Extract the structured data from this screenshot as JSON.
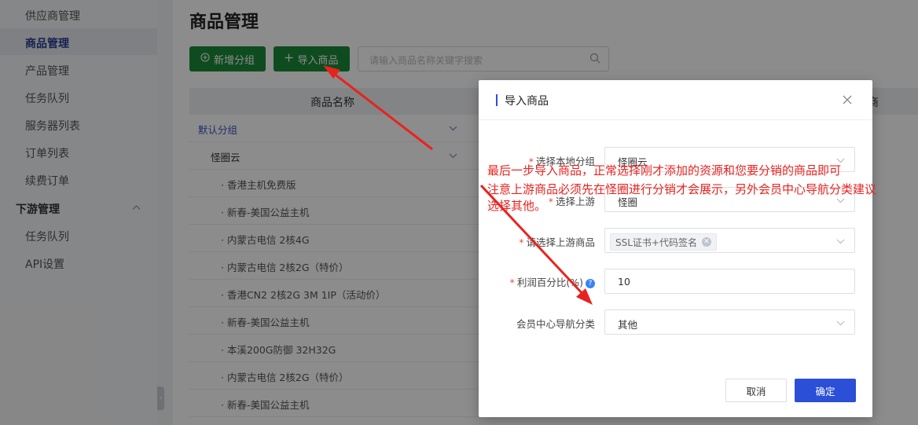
{
  "sidebar": {
    "items": [
      {
        "label": "供应商管理"
      },
      {
        "label": "商品管理",
        "active": true
      },
      {
        "label": "产品管理"
      },
      {
        "label": "任务队列"
      },
      {
        "label": "服务器列表"
      },
      {
        "label": "订单列表"
      },
      {
        "label": "续费订单"
      }
    ],
    "group": {
      "label": "下游管理",
      "icon": "chevron-up-icon"
    },
    "group_items": [
      {
        "label": "任务队列"
      },
      {
        "label": "API设置"
      }
    ]
  },
  "page": {
    "title": "商品管理"
  },
  "toolbar": {
    "add_group_label": "新增分组",
    "import_label": "导入商品",
    "search_placeholder": "请输入商品名称关键字搜索"
  },
  "table": {
    "headers": [
      "商品名称",
      "商"
    ],
    "rows": [
      {
        "label": "默认分组",
        "type": "group"
      },
      {
        "label": "怪圈云",
        "type": "subgroup"
      },
      {
        "label": "· 香港主机免费版",
        "type": "item"
      },
      {
        "label": "· 新春-美国公益主机",
        "type": "item"
      },
      {
        "label": "· 内蒙古电信 2核4G",
        "type": "item"
      },
      {
        "label": "· 内蒙古电信 2核2G（特价）",
        "type": "item"
      },
      {
        "label": "· 香港CN2 2核2G 3M 1IP（活动价）",
        "type": "item"
      },
      {
        "label": "· 新春-美国公益主机",
        "type": "item"
      },
      {
        "label": "· 本溪200G防御 32H32G",
        "type": "item"
      },
      {
        "label": "· 内蒙古电信 2核2G（特价）",
        "type": "item"
      },
      {
        "label": "· 新春-美国公益主机",
        "type": "item"
      }
    ]
  },
  "modal": {
    "title": "导入商品",
    "fields": [
      {
        "label": "选择本地分组",
        "required": true,
        "value": "怪圈云"
      },
      {
        "label": "选择上游",
        "required": true,
        "value": "怪圈"
      },
      {
        "label": "请选择上游商品",
        "required": true,
        "tag": "SSL证书+代码签名"
      },
      {
        "label": "利润百分比(%)",
        "required": true,
        "value": "10",
        "help": "?"
      },
      {
        "label": "会员中心导航分类",
        "required": false,
        "value": "其他"
      }
    ],
    "cancel_label": "取消",
    "confirm_label": "确定"
  },
  "annotation": {
    "lines": [
      "最后一步导入商品，正常选择刚才添加的资源和您要分销的商品即可",
      "注意上游商品必须先在怪圈进行分销才会展示，另外会员中心导航分类建议",
      "选择其他。"
    ],
    "color": "#e8231f"
  },
  "colors": {
    "primary_green": "#1a8a3a",
    "primary_blue": "#2b4fd6",
    "sidebar_active": "#2a3b8f"
  }
}
